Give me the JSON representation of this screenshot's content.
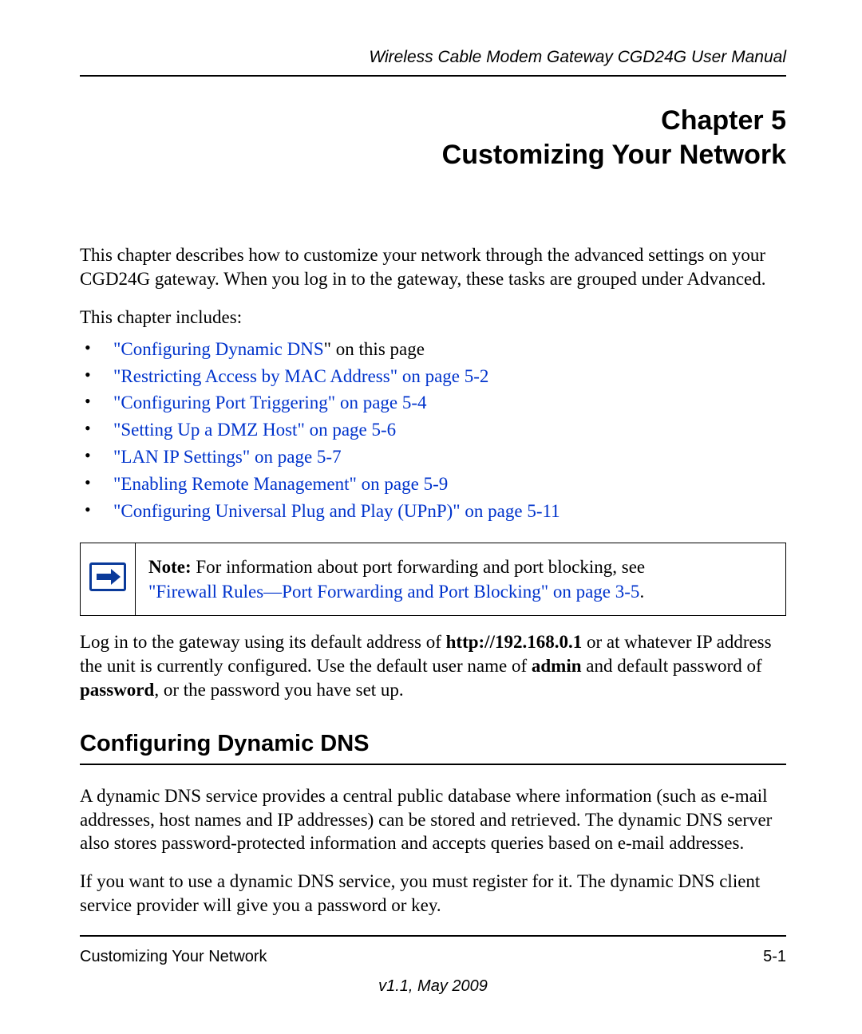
{
  "header": {
    "running": "Wireless Cable Modem Gateway CGD24G User Manual"
  },
  "chapter": {
    "line1": "Chapter 5",
    "line2": "Customizing Your Network"
  },
  "intro": {
    "p1": "This chapter describes how to customize your network through the advanced settings on your CGD24G gateway. When you log in to the gateway, these tasks are grouped under Advanced.",
    "p2": "This chapter includes:"
  },
  "toc": [
    {
      "link": "\"Configuring Dynamic DNS",
      "suffix": "\" on this page"
    },
    {
      "link": "\"Restricting Access by MAC Address\" on page 5-2",
      "suffix": ""
    },
    {
      "link": "\"Configuring Port Triggering\" on page 5-4",
      "suffix": ""
    },
    {
      "link": "\"Setting Up a DMZ Host\" on page 5-6",
      "suffix": ""
    },
    {
      "link": "\"LAN IP Settings\" on page 5-7",
      "suffix": ""
    },
    {
      "link": "\"Enabling Remote Management\" on page 5-9",
      "suffix": ""
    },
    {
      "link": "\"Configuring Universal Plug and Play (UPnP)\" on page 5-11",
      "suffix": ""
    }
  ],
  "note": {
    "label": "Note:",
    "text_before_link": " For information about port forwarding and port blocking, see ",
    "link": "\"Firewall Rules—Port Forwarding and Port Blocking\" on page 3-5",
    "after_link": "."
  },
  "login": {
    "pre1": "Log in to the gateway using its default address of ",
    "bold_url": "http://192.168.0.1",
    "mid1": " or at whatever IP address the unit is currently configured. Use the default user name of ",
    "bold_user": "admin",
    "mid2": " and default password of ",
    "bold_pass": "password",
    "post": ", or the password you have set up."
  },
  "section": {
    "title": "Configuring Dynamic DNS",
    "p1": "A dynamic DNS service provides a central public database where information (such as e-mail addresses, host names and IP addresses) can be stored and retrieved. The dynamic DNS server also stores password-protected information and accepts queries based on e-mail addresses.",
    "p2": "If you want to use a dynamic DNS service, you must register for it. The dynamic DNS client service provider will give you a password or key."
  },
  "footer": {
    "left": "Customizing Your Network",
    "right": "5-1",
    "version": "v1.1, May 2009"
  }
}
